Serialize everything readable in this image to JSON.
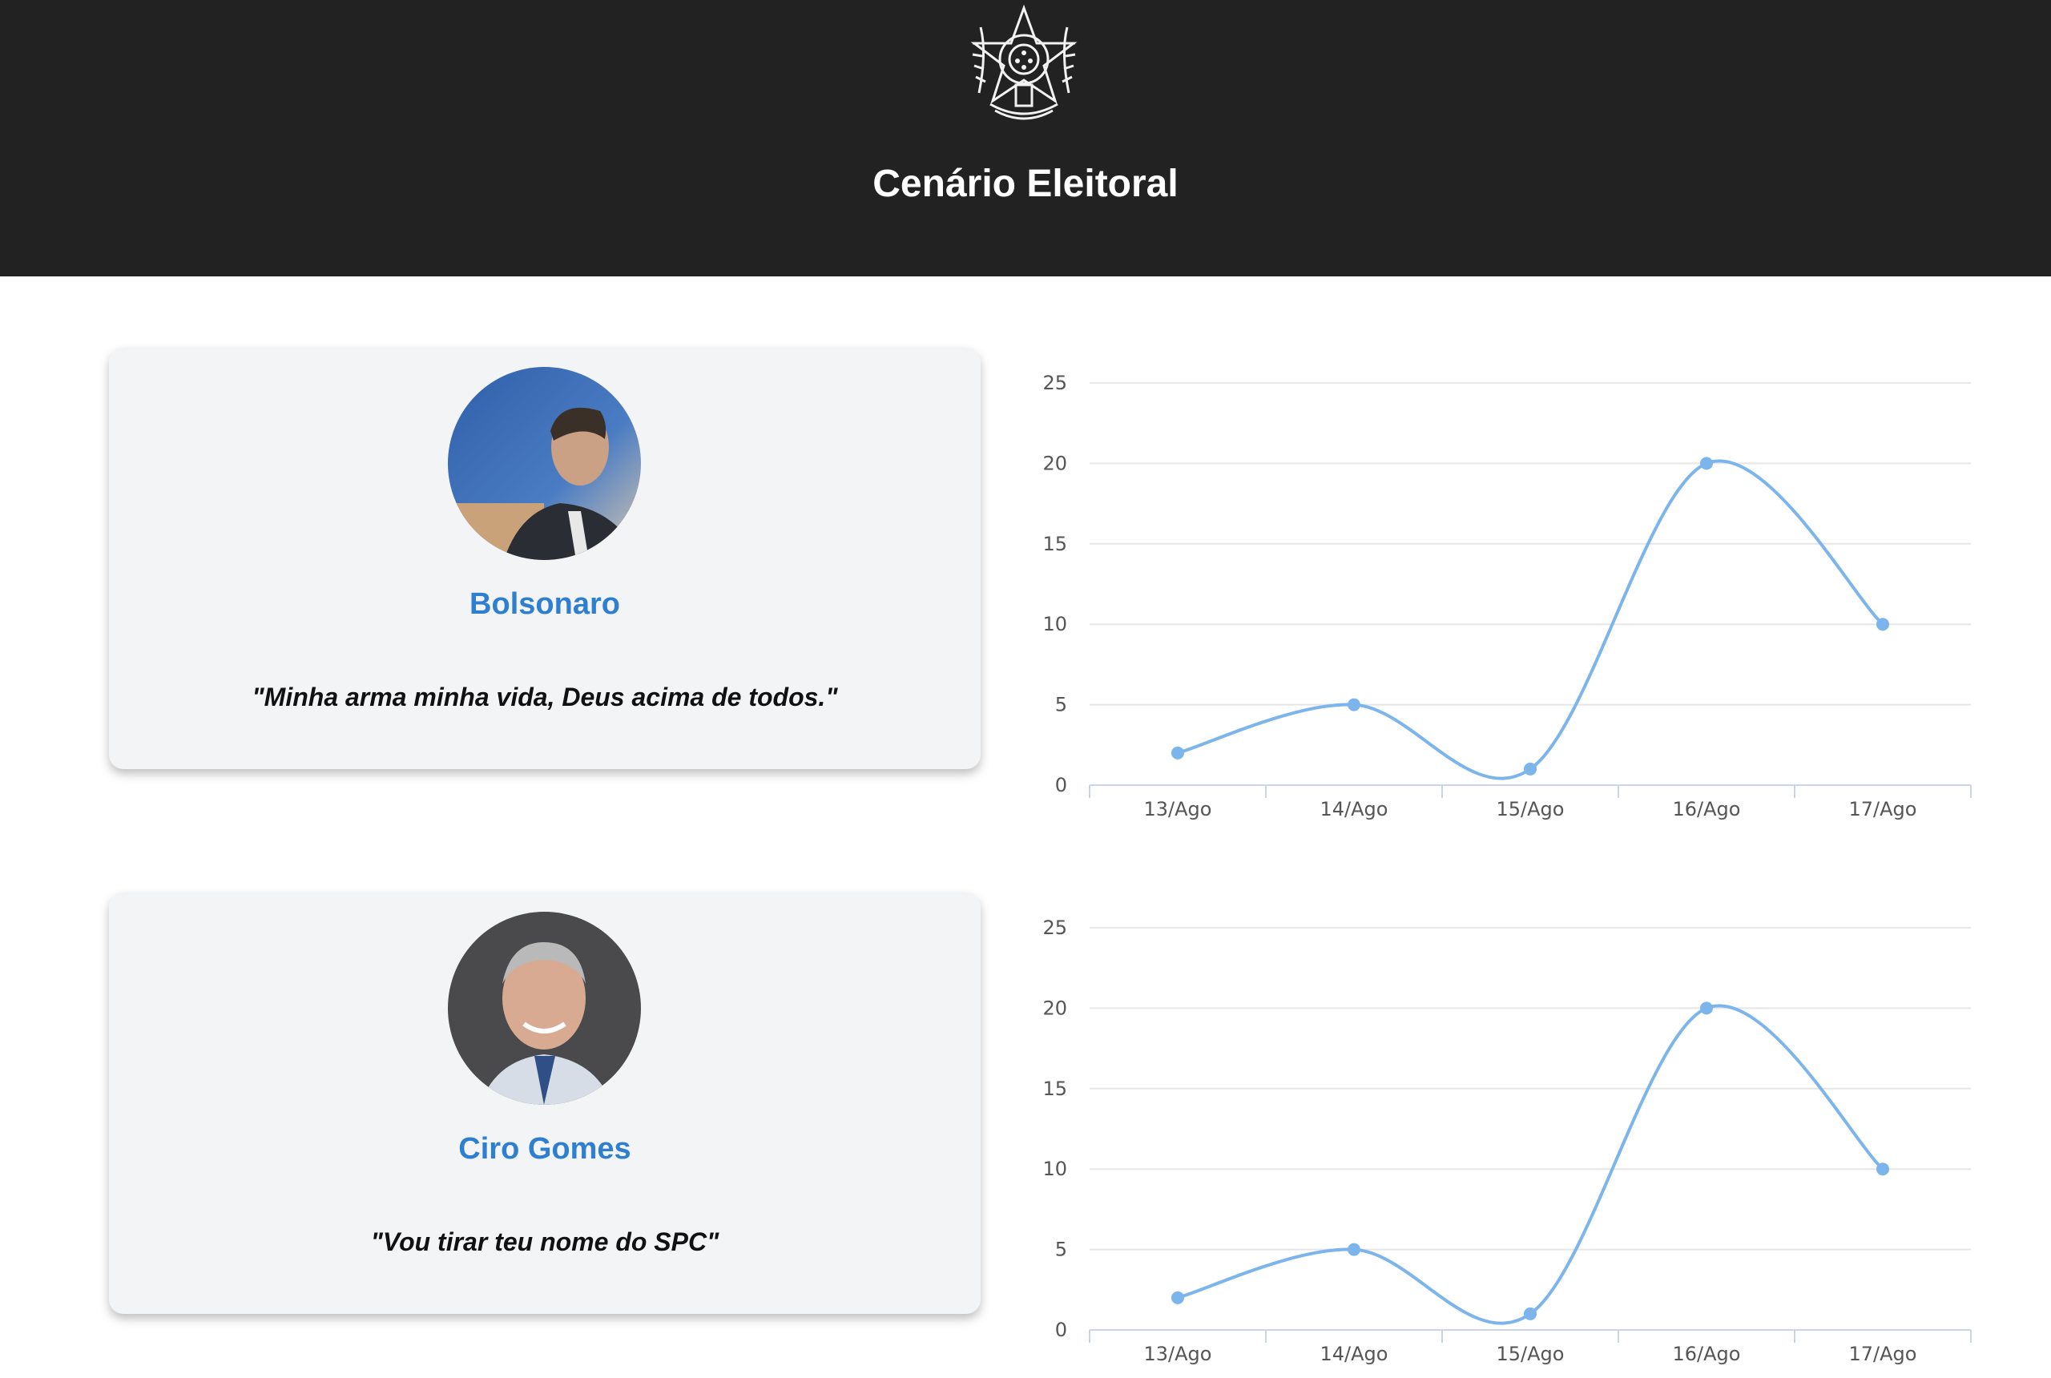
{
  "header": {
    "title": "Cenário Eleitoral",
    "logo_icon": "brazil-coat-of-arms-icon",
    "background_color": "#222222"
  },
  "candidates": [
    {
      "name": "Bolsonaro",
      "quote": "\"Minha arma minha vida, Deus acima de todos.\"",
      "avatar_icon": "candidate-photo"
    },
    {
      "name": "Ciro Gomes",
      "quote": "\"Vou tirar teu nome do SPC\"",
      "avatar_icon": "candidate-photo"
    }
  ],
  "colors": {
    "accent": "#2f7fd0",
    "series": "#7cb5ec",
    "card_background": "#f3f4f6"
  },
  "chart_data": [
    {
      "type": "line",
      "categories": [
        "13/Ago",
        "14/Ago",
        "15/Ago",
        "16/Ago",
        "17/Ago"
      ],
      "series": [
        {
          "values": [
            2,
            5,
            1,
            20,
            10
          ]
        }
      ],
      "y_ticks": [
        "0",
        "5",
        "10",
        "15",
        "20",
        "25"
      ],
      "ylim": [
        0,
        25
      ],
      "grid": true,
      "smooth": true
    },
    {
      "type": "line",
      "categories": [
        "13/Ago",
        "14/Ago",
        "15/Ago",
        "16/Ago",
        "17/Ago"
      ],
      "series": [
        {
          "values": [
            2,
            5,
            1,
            20,
            10
          ]
        }
      ],
      "y_ticks": [
        "0",
        "5",
        "10",
        "15",
        "20",
        "25"
      ],
      "ylim": [
        0,
        25
      ],
      "grid": true,
      "smooth": true
    }
  ]
}
